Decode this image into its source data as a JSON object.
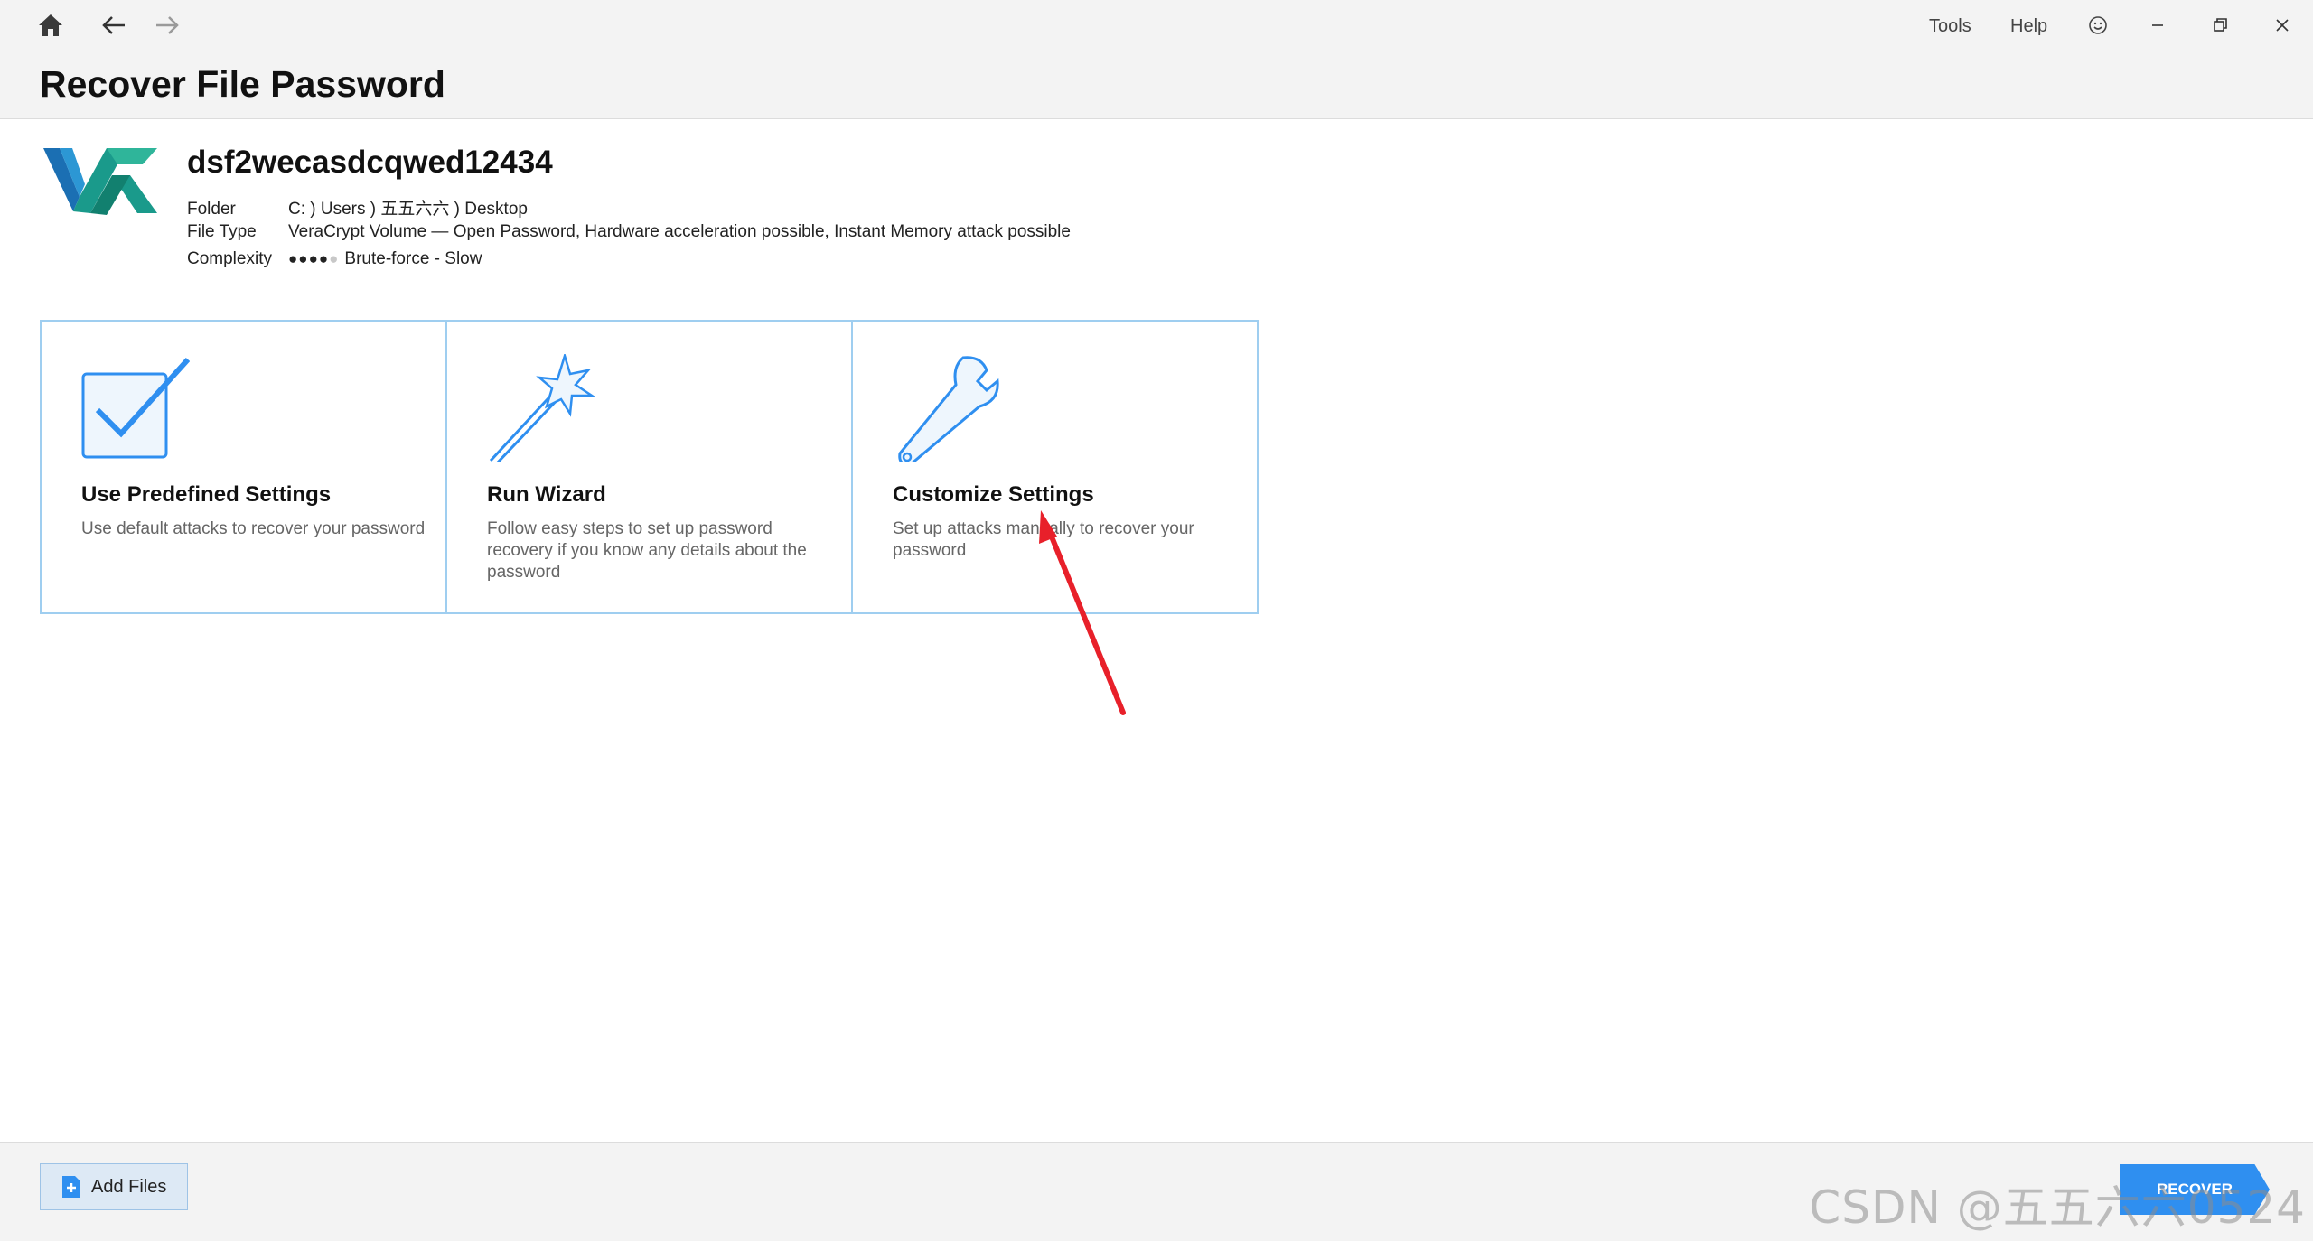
{
  "header": {
    "title": "Recover File Password",
    "menu": {
      "tools": "Tools",
      "help": "Help"
    }
  },
  "file": {
    "name": "dsf2wecasdcqwed12434",
    "rows": [
      {
        "label": "Folder",
        "value": "C: ) Users ) 五五六六 ) Desktop"
      },
      {
        "label": "File Type",
        "value": "VeraCrypt Volume — Open Password, Hardware acceleration possible, Instant Memory attack possible"
      },
      {
        "label": "Complexity",
        "value": "Brute-force - Slow"
      }
    ],
    "complexity_level": 4,
    "complexity_max": 5
  },
  "options": [
    {
      "title": "Use Predefined Settings",
      "description": "Use default attacks to recover your password",
      "icon": "checkbox-icon"
    },
    {
      "title": "Run Wizard",
      "description": "Follow easy steps to set up password recovery if you know any details about the password",
      "icon": "magic-wand-icon"
    },
    {
      "title": "Customize Settings",
      "description": "Set up attacks manually to recover your password",
      "icon": "wrench-icon"
    }
  ],
  "footer": {
    "add_files": "Add Files",
    "recover": "RECOVER"
  },
  "watermark": "CSDN @五五六六0524",
  "colors": {
    "accent": "#2f8ff0",
    "card_border": "#9fcef0",
    "annotation": "#e8202a"
  }
}
